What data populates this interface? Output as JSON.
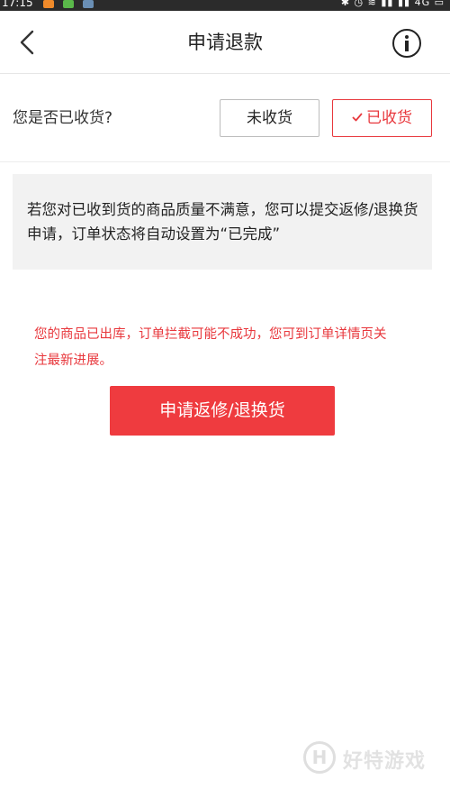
{
  "status_bar": {
    "time": "17:15",
    "network": "4G",
    "icons": [
      "bluetooth-icon",
      "alarm-icon",
      "wifi-icon",
      "signal-icon",
      "signal-icon",
      "battery-icon"
    ],
    "app_colors": [
      "#f08a2a",
      "#5ab84a",
      "#6a8fb5"
    ]
  },
  "header": {
    "title": "申请退款",
    "back_icon": "chevron-left-icon",
    "info_icon": "info-circle-icon"
  },
  "received": {
    "question": "您是否已收货?",
    "option_not_received": "未收货",
    "option_received": "已收货",
    "selected": "已收货"
  },
  "notice": {
    "text": "若您对已收到货的商品质量不满意，您可以提交返修/退换货申请，订单状态将自动设置为“已完成”"
  },
  "warning": {
    "text": "您的商品已出库，订单拦截可能不成功，您可到订单详情页关注最新进展。"
  },
  "apply_button": {
    "label": "申请返修/退换货"
  },
  "watermark": {
    "logo_letter": "H",
    "text": "好特游戏"
  },
  "colors": {
    "accent": "#ef3b3f",
    "warning": "#e8383d",
    "notice_bg": "#f2f2f2"
  }
}
